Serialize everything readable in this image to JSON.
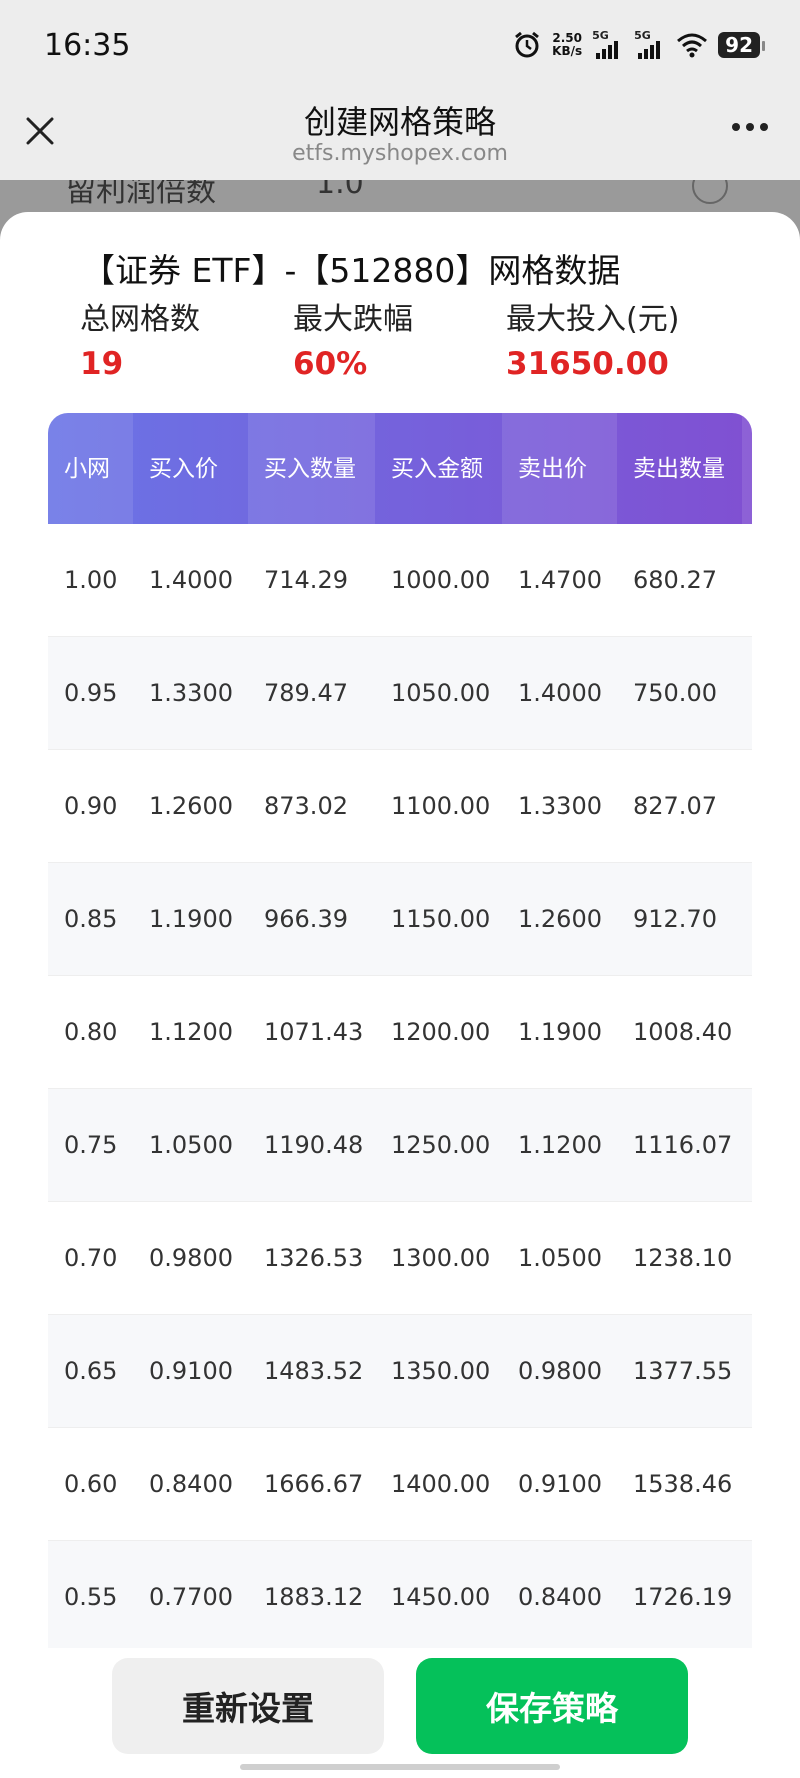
{
  "status_bar": {
    "time": "16:35",
    "net_speed_value": "2.50",
    "net_speed_unit": "KB/s",
    "signal1_label": "5G",
    "signal2_label": "5G",
    "battery": "92"
  },
  "nav": {
    "title": "创建网格策略",
    "subtitle": "etfs.myshopex.com"
  },
  "background_peek": {
    "label": "留利润倍数",
    "value": "1.0"
  },
  "sheet": {
    "title": "【证券 ETF】-【512880】网格数据",
    "summary": [
      {
        "label": "总网格数",
        "value": "19"
      },
      {
        "label": "最大跌幅",
        "value": "60%"
      },
      {
        "label": "最大投入(元)",
        "value": "31650.00"
      }
    ],
    "table": {
      "headers": [
        "小网",
        "买入价",
        "买入数量",
        "买入金额",
        "卖出价",
        "卖出数量"
      ],
      "rows": [
        [
          "1.00",
          "1.4000",
          "714.29",
          "1000.00",
          "1.4700",
          "680.27"
        ],
        [
          "0.95",
          "1.3300",
          "789.47",
          "1050.00",
          "1.4000",
          "750.00"
        ],
        [
          "0.90",
          "1.2600",
          "873.02",
          "1100.00",
          "1.3300",
          "827.07"
        ],
        [
          "0.85",
          "1.1900",
          "966.39",
          "1150.00",
          "1.2600",
          "912.70"
        ],
        [
          "0.80",
          "1.1200",
          "1071.43",
          "1200.00",
          "1.1900",
          "1008.40"
        ],
        [
          "0.75",
          "1.0500",
          "1190.48",
          "1250.00",
          "1.1200",
          "1116.07"
        ],
        [
          "0.70",
          "0.9800",
          "1326.53",
          "1300.00",
          "1.0500",
          "1238.10"
        ],
        [
          "0.65",
          "0.9100",
          "1483.52",
          "1350.00",
          "0.9800",
          "1377.55"
        ],
        [
          "0.60",
          "0.8400",
          "1666.67",
          "1400.00",
          "0.9100",
          "1538.46"
        ],
        [
          "0.55",
          "0.7700",
          "1883.12",
          "1450.00",
          "0.8400",
          "1726.19"
        ]
      ]
    }
  },
  "footer": {
    "reset_label": "重新设置",
    "save_label": "保存策略"
  },
  "colors": {
    "accent_red": "#e02424",
    "save_green": "#05c15a",
    "header_gradient_start": "#6a74e6",
    "header_gradient_end": "#8050d2"
  }
}
